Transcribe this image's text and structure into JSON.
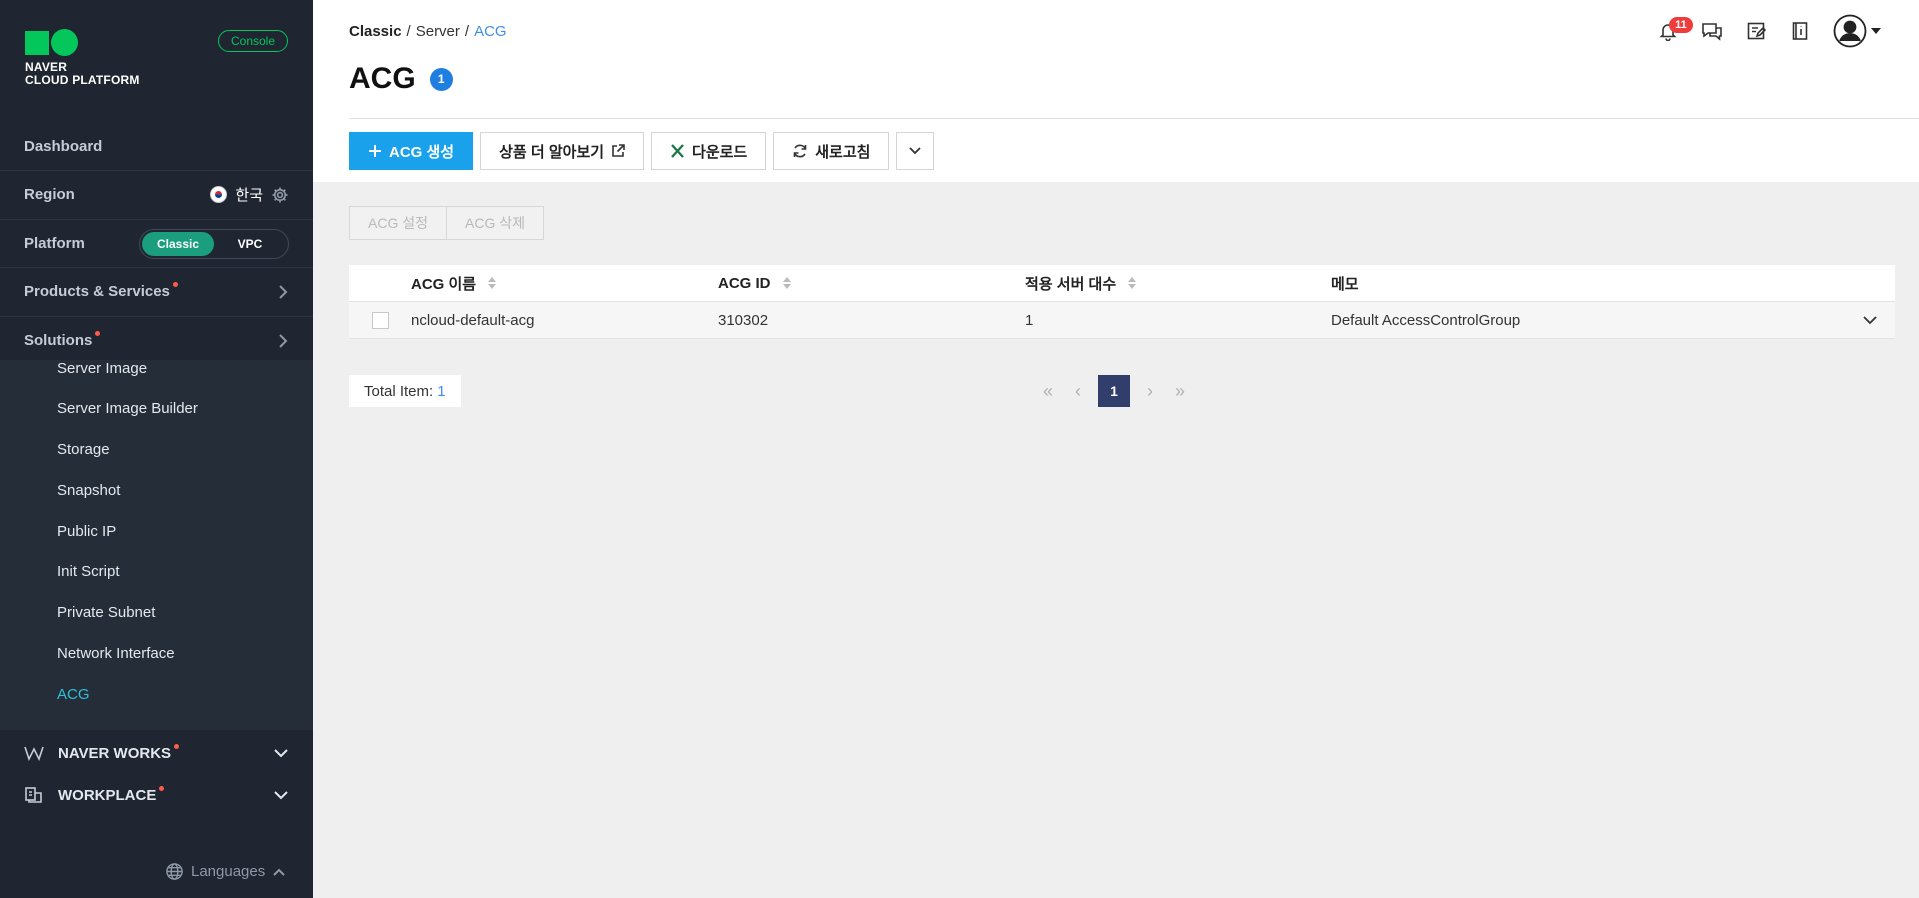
{
  "sidebar": {
    "brand_line1": "NAVER",
    "brand_line2": "CLOUD PLATFORM",
    "console_label": "Console",
    "dashboard": "Dashboard",
    "region_label": "Region",
    "region_value": "한국",
    "platform_label": "Platform",
    "platform_options": [
      "Classic",
      "VPC"
    ],
    "platform_selected": "Classic",
    "products_label": "Products & Services",
    "solutions_label": "Solutions",
    "submenu": [
      "Server Image",
      "Server Image Builder",
      "Storage",
      "Snapshot",
      "Public IP",
      "Init Script",
      "Private Subnet",
      "Network Interface",
      "ACG"
    ],
    "submenu_active": "ACG",
    "naver_works": "NAVER WORKS",
    "workplace": "WORKPLACE",
    "languages": "Languages"
  },
  "breadcrumb": [
    "Classic",
    "Server",
    "ACG"
  ],
  "page": {
    "title": "ACG",
    "count": "1"
  },
  "notifications": {
    "count": "11"
  },
  "toolbar": {
    "create": "ACG 생성",
    "learn_more": "상품 더 알아보기",
    "download": "다운로드",
    "refresh": "새로고침"
  },
  "actions": {
    "settings": "ACG 설정",
    "delete": "ACG 삭제"
  },
  "table": {
    "headers": {
      "name": "ACG 이름",
      "id": "ACG ID",
      "servers": "적용 서버 대수",
      "memo": "메모"
    },
    "rows": [
      {
        "name": "ncloud-default-acg",
        "id": "310302",
        "servers": "1",
        "memo": "Default AccessControlGroup"
      }
    ]
  },
  "footer": {
    "total_label": "Total Item:",
    "total_value": "1",
    "current_page": "1"
  },
  "colors": {
    "accent": "#1aa1eb",
    "brand": "#03c75a",
    "sidebar_bg": "#1f2631",
    "active_menu": "#2cc0d8",
    "pager_active": "#313d6b"
  }
}
